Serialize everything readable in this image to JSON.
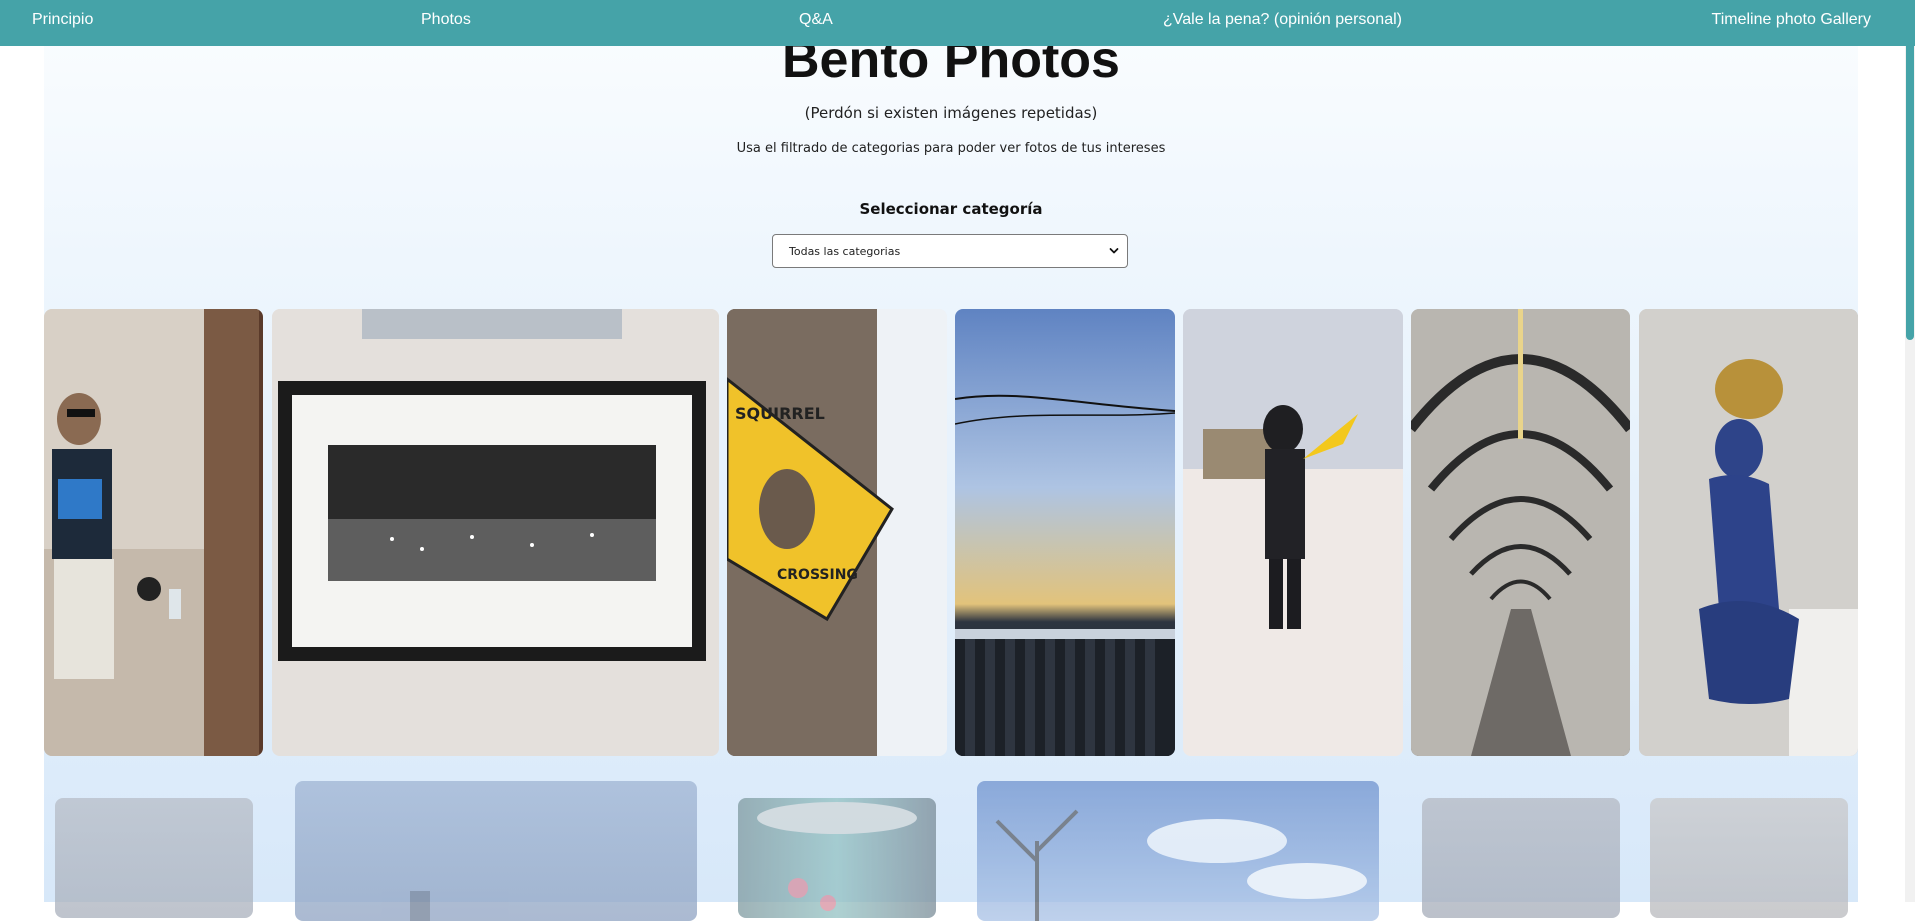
{
  "nav": {
    "items": [
      "Principio",
      "Photos",
      "Q&A",
      "¿Vale la pena? (opinión personal)",
      "Timeline photo Gallery"
    ]
  },
  "header": {
    "title": "Bento Photos",
    "subtitle": "(Perdón si existen imágenes repetidas)",
    "hint": "Usa el filtrado de categorias para poder ver fotos de tus intereses"
  },
  "filter": {
    "label": "Seleccionar categoría",
    "selected": "Todas las categorias",
    "icon": "chevron-down-icon"
  },
  "gallery": {
    "row1": [
      {
        "name": "photo-mirror-selfie"
      },
      {
        "name": "photo-framed-city-print"
      },
      {
        "name": "photo-squirrel-crossing-sign"
      },
      {
        "name": "photo-sky-over-fence"
      },
      {
        "name": "photo-person-in-snow"
      },
      {
        "name": "photo-arched-walkway"
      },
      {
        "name": "photo-blue-statue"
      }
    ],
    "squirrel_sign_text": [
      "SQUIRREL",
      "CROSSING"
    ]
  },
  "colors": {
    "nav_bg": "#45a3a8",
    "nav_text": "#ffffff",
    "scroll_thumb": "#45a3a8"
  }
}
